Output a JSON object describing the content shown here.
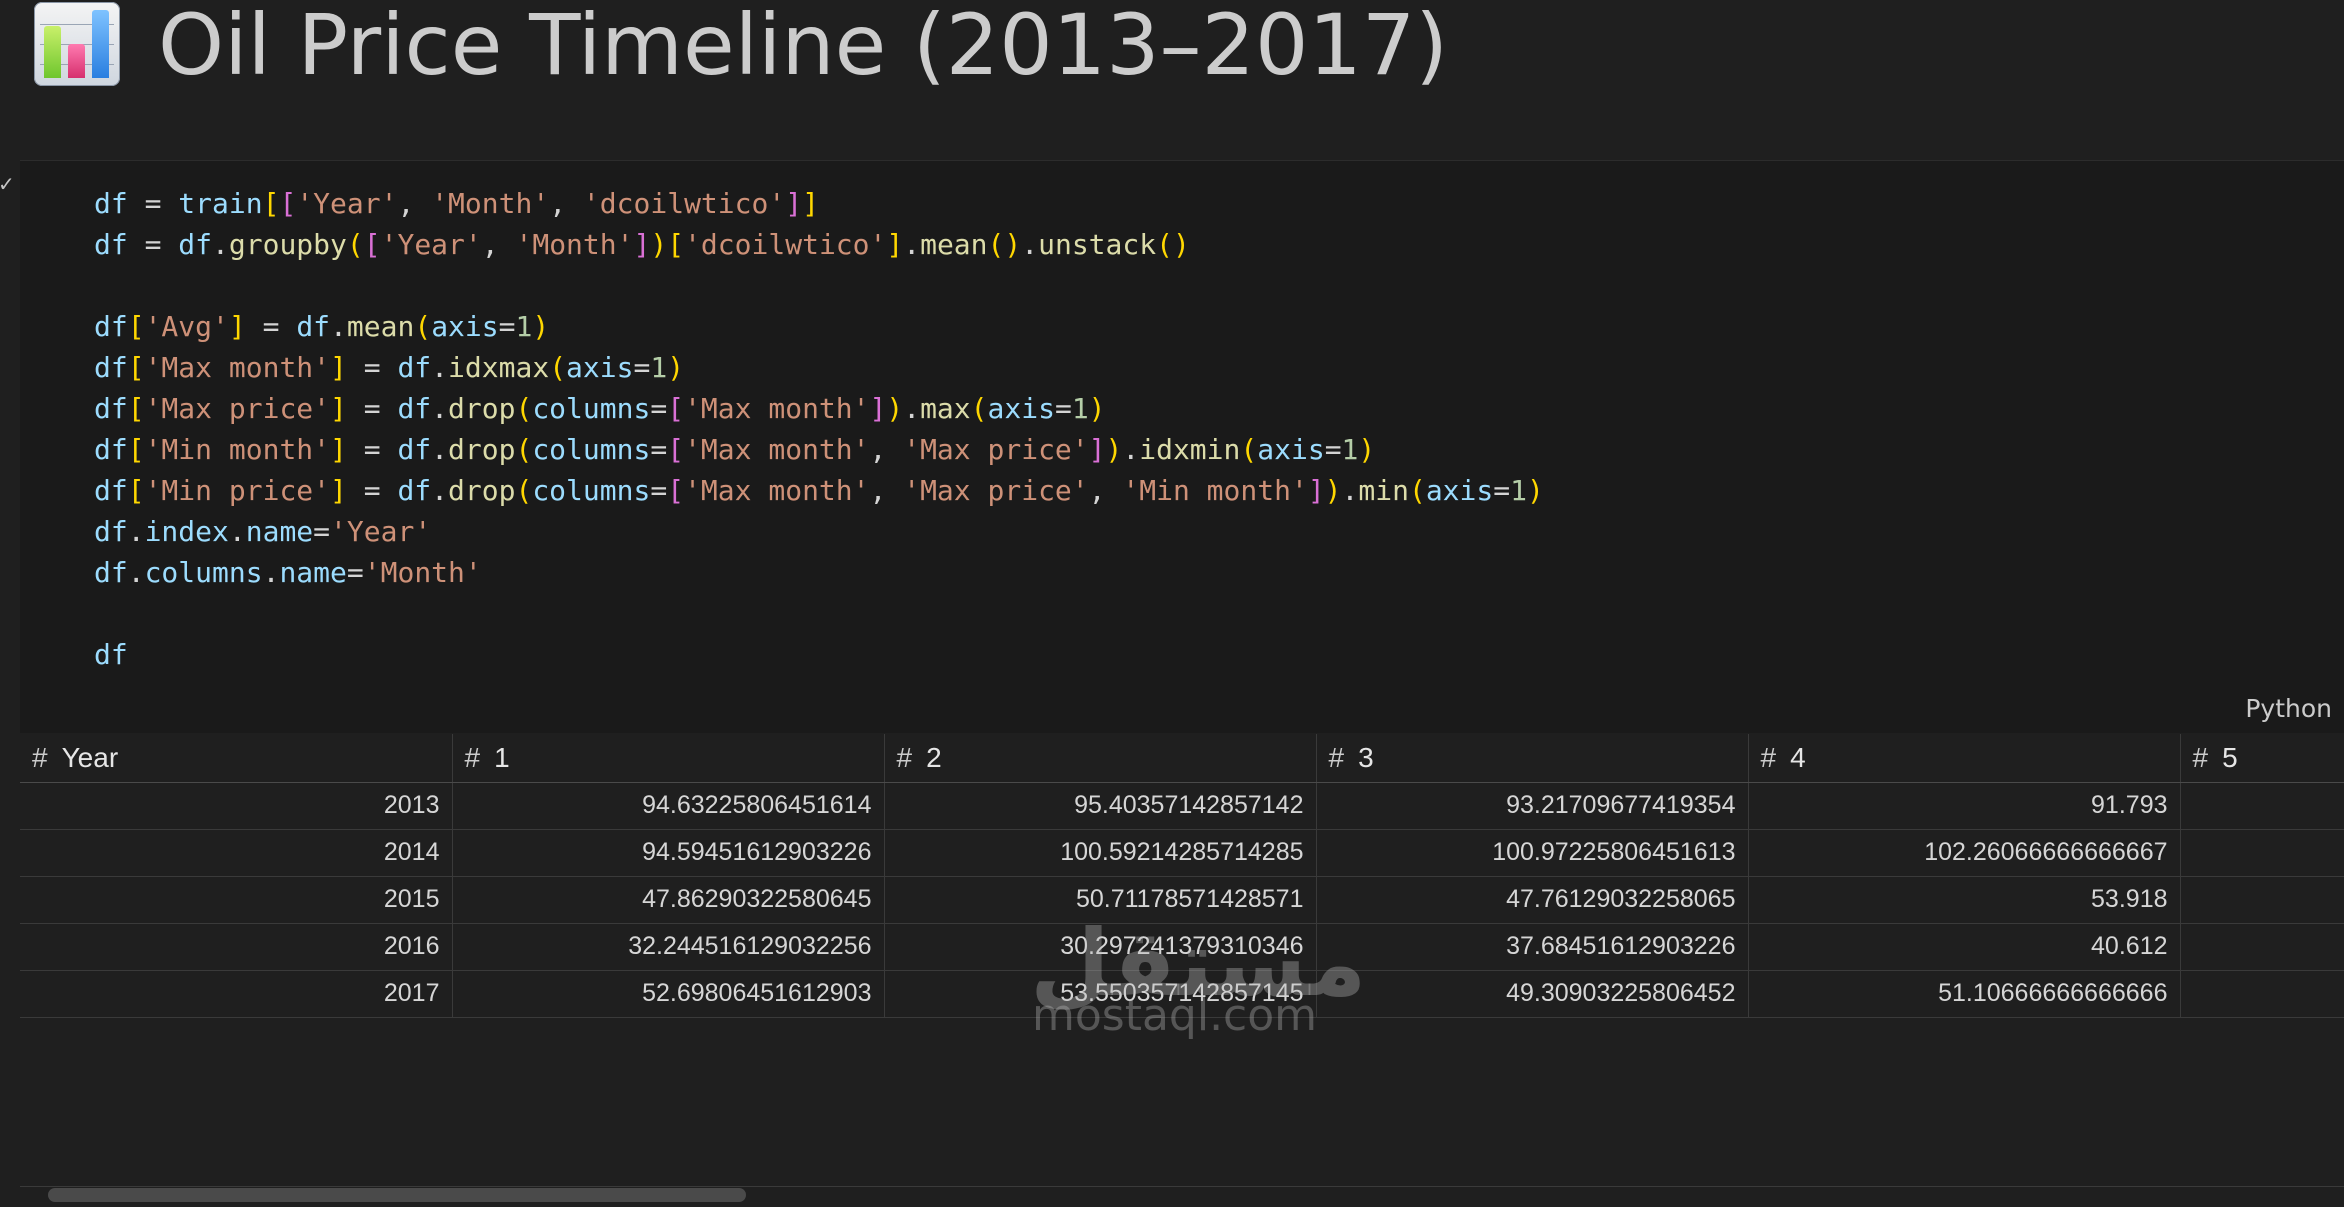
{
  "header": {
    "title": "Oil Price Timeline (2013–2017)",
    "icon": "bar-chart-icon"
  },
  "cell": {
    "language": "Python",
    "status_icon": "check-icon",
    "code_lines": [
      "df = train[['Year', 'Month', 'dcoilwtico']]",
      "df = df.groupby(['Year', 'Month'])['dcoilwtico'].mean().unstack()",
      "",
      "df['Avg'] = df.mean(axis=1)",
      "df['Max month'] = df.idxmax(axis=1)",
      "df['Max price'] = df.drop(columns=['Max month']).max(axis=1)",
      "df['Min month'] = df.drop(columns=['Max month', 'Max price']).idxmin(axis=1)",
      "df['Min price'] = df.drop(columns=['Max month', 'Max price', 'Min month']).min(axis=1)",
      "df.index.name='Year'",
      "df.columns.name='Month'",
      "",
      "df"
    ]
  },
  "table": {
    "columns": [
      "Year",
      "1",
      "2",
      "3",
      "4",
      "5"
    ],
    "rows": [
      [
        "2013",
        "94.63225806451614",
        "95.40357142857142",
        "93.21709677419354",
        "91.793",
        ""
      ],
      [
        "2014",
        "94.59451612903226",
        "100.59214285714285",
        "100.97225806451613",
        "102.26066666666667",
        ""
      ],
      [
        "2015",
        "47.86290322580645",
        "50.71178571428571",
        "47.76129032258065",
        "53.918",
        ""
      ],
      [
        "2016",
        "32.244516129032256",
        "30.297241379310346",
        "37.68451612903226",
        "40.612",
        ""
      ],
      [
        "2017",
        "52.69806451612903",
        "53.550357142857145",
        "49.30903225806452",
        "51.10666666666666",
        ""
      ]
    ]
  },
  "watermark": {
    "arabic": "مستقل",
    "latin": "mostaql.com"
  },
  "colors": {
    "background": "#1f1f1f",
    "editor_bg": "#1a1a1a",
    "string": "#ce9178",
    "variable": "#9cdcfe",
    "function": "#dcdcaa",
    "number": "#b5cea8"
  }
}
